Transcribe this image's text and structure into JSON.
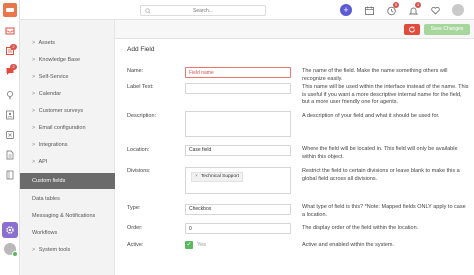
{
  "topbar": {
    "search_placeholder": "Search...",
    "plus_label": "+",
    "badge_counts": [
      "5",
      "4"
    ]
  },
  "rail": {
    "badges": [
      "2",
      "2"
    ]
  },
  "header": {
    "save_label": "Save Changes"
  },
  "nav": {
    "items": [
      {
        "label": "Assets",
        "chevron": ">"
      },
      {
        "label": "Knowledge Base",
        "chevron": ">"
      },
      {
        "label": "Self-Service",
        "chevron": ">"
      },
      {
        "label": "Calendar",
        "chevron": ">"
      },
      {
        "label": "Customer surveys",
        "chevron": ">"
      },
      {
        "label": "Email configuration",
        "chevron": ">"
      },
      {
        "label": "Integrations",
        "chevron": ">"
      },
      {
        "label": "API",
        "chevron": ">"
      },
      {
        "label": "Custom fields",
        "chevron": ""
      },
      {
        "label": "Data tables",
        "chevron": ""
      },
      {
        "label": "Messaging & Notifications",
        "chevron": ""
      },
      {
        "label": "Workflows",
        "chevron": ""
      },
      {
        "label": "System tools",
        "chevron": ">"
      }
    ]
  },
  "form": {
    "title": "Add Field",
    "name": {
      "label": "Name:",
      "placeholder": "Field name",
      "help": "The name of the field. Make the name something others will recognize easily."
    },
    "label_text": {
      "label": "Label Text:",
      "help": "This name will be used within the interface instead of the name. This is useful if you want a more descriptive internal name for the field, but a more user friendly one for agents."
    },
    "description": {
      "label": "Description:",
      "help": "A description of your field and what it should be used for."
    },
    "location": {
      "label": "Location:",
      "value": "Case field",
      "help": "Where the field will be located in. This field will only be available within this object."
    },
    "divisions": {
      "label": "Divisions:",
      "chip_remove": "×",
      "chip": "Technical Support",
      "help": "Restrict the field to certain divisions or leave blank to make this a global field across all divisions."
    },
    "type": {
      "label": "Type:",
      "value": "Checkbox",
      "help": "What type of field is this? *Note: Mapped fields ONLY apply to case a location."
    },
    "order": {
      "label": "Order:",
      "value": "0",
      "help": "The display order of the field within the location."
    },
    "active": {
      "label": "Active:",
      "check": "✓",
      "value": "Yes",
      "help": "Active and enabled within the system."
    }
  },
  "colors": {
    "accent": "#5b5bd6",
    "settings_accent": "#8a6fd0",
    "danger": "#e24b3b",
    "save_button": "#a6d69c",
    "active_nav": "#6b6b6b",
    "checkbox": "#5cb85c"
  }
}
